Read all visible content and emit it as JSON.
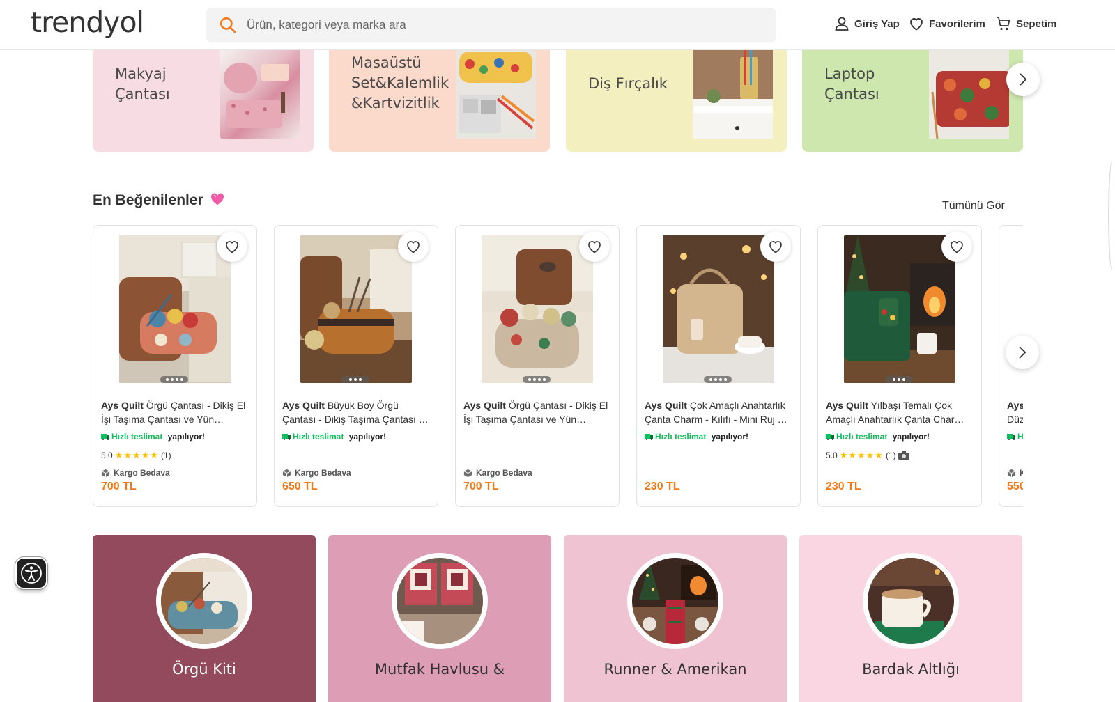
{
  "header": {
    "logo": "trendyol",
    "search_placeholder": "Ürün, kategori veya marka ara",
    "login": "Giriş Yap",
    "favorites": "Favorilerim",
    "cart": "Sepetim"
  },
  "category_banners": [
    {
      "label": "Makyaj\nÇantası",
      "bg": "#f7dce4"
    },
    {
      "label": "Masaüstü\nSet&Kalemlik\n&Kartvizitlik",
      "bg": "#fbd9cb"
    },
    {
      "label": "Diş Fırçalık",
      "bg": "#f4efbf"
    },
    {
      "label": "Laptop\nÇantası",
      "bg": "#cde7ae"
    }
  ],
  "section": {
    "title": "En Beğenilenler",
    "see_all": "Tümünü Gör"
  },
  "products": [
    {
      "brand": "Ays Quilt",
      "name": "Örgü Çantası - Dikiş El İşi Taşıma Çantası ve Yün…",
      "fast_green": "Hızlı teslimat",
      "fast_rest": "yapılıyor!",
      "rating": "5.0",
      "stars": "★★★★★",
      "reviews": "(1)",
      "cargo": "Kargo Bedava",
      "price": "700 TL"
    },
    {
      "brand": "Ays Quilt",
      "name": "Büyük Boy Örgü Çantası - Dikiş Taşıma Çantası …",
      "fast_green": "Hızlı teslimat",
      "fast_rest": "yapılıyor!",
      "rating": "",
      "stars": "",
      "reviews": "",
      "cargo": "Kargo Bedava",
      "price": "650 TL"
    },
    {
      "brand": "Ays Quilt",
      "name": "Örgü Çantası - Dikiş El İşi Taşıma Çantası ve Yün…",
      "fast_green": "",
      "fast_rest": "",
      "rating": "",
      "stars": "",
      "reviews": "",
      "cargo": "Kargo Bedava",
      "price": "700 TL"
    },
    {
      "brand": "Ays Quilt",
      "name": "Çok Amaçlı Anahtarlık Çanta Charm - Kılıfı - Mini Ruj …",
      "fast_green": "Hızlı teslimat",
      "fast_rest": "yapılıyor!",
      "rating": "",
      "stars": "",
      "reviews": "",
      "cargo": "",
      "price": "230 TL"
    },
    {
      "brand": "Ays Quilt",
      "name": "Yılbaşı Temalı Çok Amaçlı Anahtarlık Çanta Char…",
      "fast_green": "Hızlı teslimat",
      "fast_rest": "yapılıyor!",
      "rating": "5.0",
      "stars": "★★★★★",
      "reviews": "(1)",
      "cargo": "",
      "price": "230 TL"
    },
    {
      "brand": "Ays",
      "name": "Düz",
      "fast_green": "H",
      "fast_rest": "",
      "rating": "",
      "stars": "",
      "reviews": "",
      "cargo": "K",
      "price": "550"
    }
  ],
  "bottom_categories": [
    {
      "label": "Örgü Kiti",
      "bg": "#934a5c",
      "color": "#ffffff"
    },
    {
      "label": "Mutfak Havlusu &",
      "bg": "#dd9db4",
      "color": "#333333"
    },
    {
      "label": "Runner & Amerikan",
      "bg": "#f0c3d3",
      "color": "#333333"
    },
    {
      "label": "Bardak Altlığı",
      "bg": "#fad6e2",
      "color": "#333333"
    }
  ],
  "colors": {
    "accent": "#f27a1a",
    "fast_green": "#0bc15c",
    "star": "#ffc000"
  }
}
